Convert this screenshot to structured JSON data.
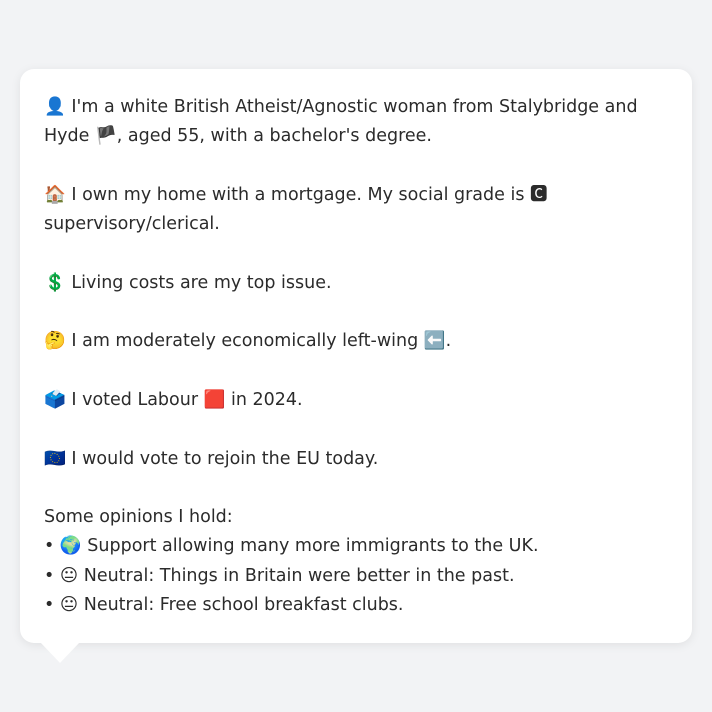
{
  "profile": {
    "intro": {
      "icon": "👤",
      "text_a": "I'm a white British Atheist/Agnostic woman from Stalybridge and Hyde ",
      "flag": "🏴",
      "text_b": ", aged 55, with a bachelor's degree."
    },
    "home": {
      "icon": "🏠",
      "text_a": "I own my home with a mortgage. My social grade is ",
      "grade_icon": "🅲",
      "text_b": " supervisory/clerical."
    },
    "issue": {
      "icon": "💲",
      "text": "Living costs are my top issue."
    },
    "economics": {
      "icon": "🤔",
      "text": "I am moderately economically left-wing ",
      "direction_icon": "⬅️",
      "suffix": "."
    },
    "vote": {
      "icon": "🗳️",
      "text_a": "I voted Labour ",
      "party_icon": "🟥",
      "text_b": " in 2024."
    },
    "eu": {
      "icon": "🇪🇺",
      "text": "I would vote to rejoin the EU today."
    },
    "opinions": {
      "heading": "Some opinions I hold:",
      "bullet": "•",
      "items": [
        {
          "icon": "🌍",
          "text": "Support allowing many more immigrants to the UK."
        },
        {
          "icon": "😐",
          "text": "Neutral: Things in Britain were better in the past."
        },
        {
          "icon": "😐",
          "text": "Neutral: Free school breakfast clubs."
        }
      ]
    }
  }
}
